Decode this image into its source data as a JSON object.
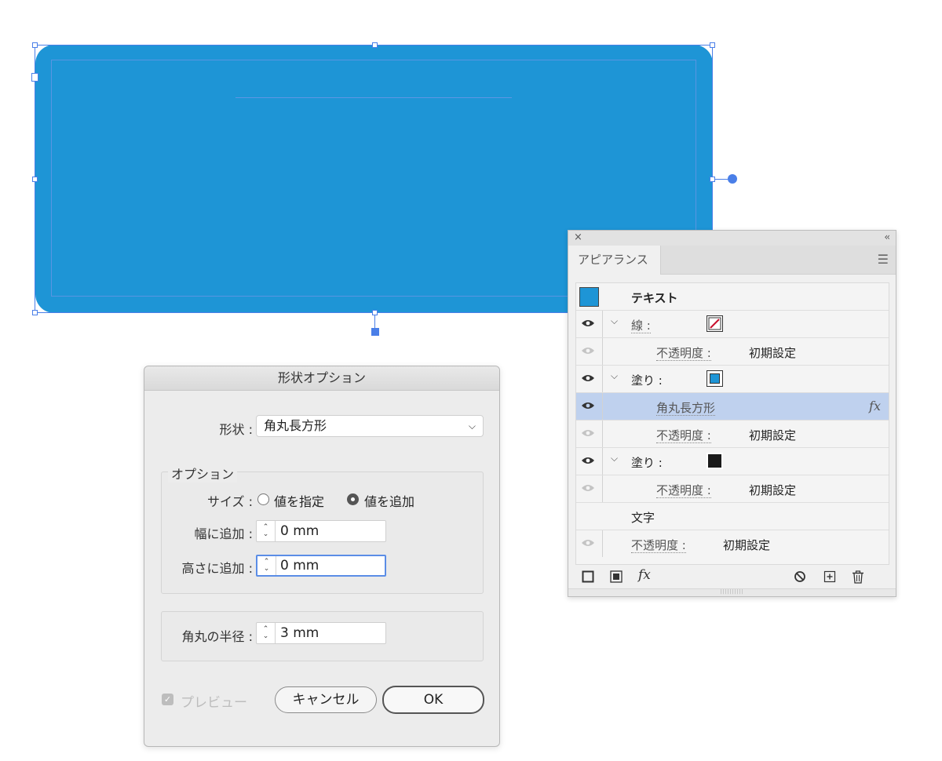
{
  "artwork": {
    "fill_color": "#1e95d6",
    "selection_color": "#4a7fe8"
  },
  "dialog": {
    "title": "形状オプション",
    "shape_label": "形状 :",
    "shape_value": "角丸長方形",
    "options_group": "オプション",
    "size_label": "サイズ :",
    "size_options": [
      "値を指定",
      "値を追加"
    ],
    "size_selected": "値を追加",
    "width_label": "幅に追加 :",
    "width_value": "0 mm",
    "height_label": "高さに追加 :",
    "height_value": "0 mm",
    "radius_label": "角丸の半径 :",
    "radius_value": "3 mm",
    "preview_label": "プレビュー",
    "preview_checked": true,
    "cancel_label": "キャンセル",
    "ok_label": "OK"
  },
  "panel": {
    "tab": "アピアランス",
    "close_glyph": "×",
    "collapse_glyph": "‹‹",
    "header_label": "テキスト",
    "header_swatch": "#1e95d6",
    "rows": [
      {
        "kind": "stroke",
        "label": "線 :",
        "swatch": "none-red-slash"
      },
      {
        "kind": "opacity",
        "label": "不透明度 :",
        "value": "初期設定"
      },
      {
        "kind": "fill",
        "label": "塗り :",
        "swatch": "#1e95d6"
      },
      {
        "kind": "effect",
        "label": "角丸長方形",
        "fx": "fx"
      },
      {
        "kind": "opacity",
        "label": "不透明度 :",
        "value": "初期設定"
      },
      {
        "kind": "fill",
        "label": "塗り :",
        "swatch": "#1a1a1a"
      },
      {
        "kind": "opacity",
        "label": "不透明度 :",
        "value": "初期設定"
      },
      {
        "kind": "characters",
        "label": "文字"
      },
      {
        "kind": "opacity",
        "label": "不透明度 :",
        "value": "初期設定"
      }
    ],
    "bottom_fx": "fx",
    "icons": [
      "add-new-stroke-icon",
      "add-new-fill-icon",
      "fx-menu-icon",
      "clear-appearance-icon",
      "duplicate-item-icon",
      "delete-item-icon"
    ]
  }
}
